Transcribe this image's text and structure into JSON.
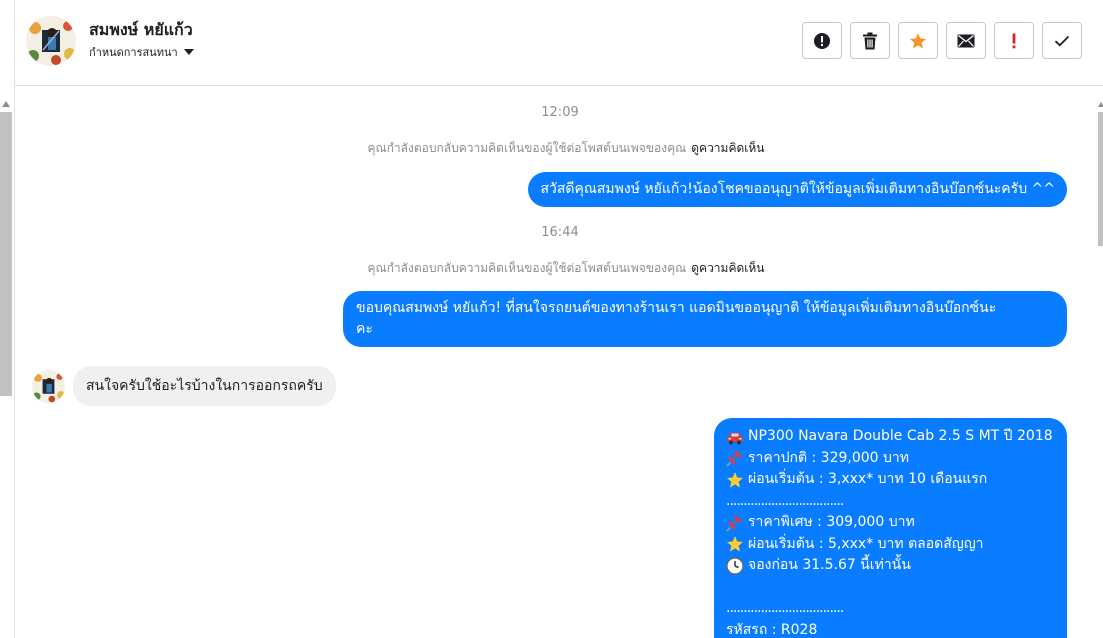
{
  "header": {
    "contact_name": "สมพงษ์ หยัแก้ว",
    "conversation_setting": "กำหนดการสนทนา",
    "actions": [
      {
        "name": "spam",
        "icon": "alert-circle-icon"
      },
      {
        "name": "delete",
        "icon": "trash-icon"
      },
      {
        "name": "star",
        "icon": "star-icon",
        "color": "#f5922a"
      },
      {
        "name": "mark-unread",
        "icon": "envelope-icon"
      },
      {
        "name": "important",
        "icon": "exclamation-icon",
        "color": "#e02020"
      },
      {
        "name": "done",
        "icon": "check-icon"
      }
    ]
  },
  "thread": {
    "time_1": "12:09",
    "notice_1": {
      "text": "คุณกำลังตอบกลับความคิดเห็นของผู้ใช้ต่อโพสต์บนเพจของคุณ",
      "link": "ดูความคิดเห็น"
    },
    "outgoing_1": "สวัสดีคุณสมพงษ์ หยัแก้ว!น้องโชคขออนุญาติให้ข้อมูลเพิ่มเติมทางอินบ๊อกซ์นะครับ ^^",
    "time_2": "16:44",
    "notice_2": {
      "text": "คุณกำลังตอบกลับความคิดเห็นของผู้ใช้ต่อโพสต์บนเพจของคุณ",
      "link": "ดูความคิดเห็น"
    },
    "outgoing_2_line1": "ขอบคุณสมพงษ์ หยัแก้ว! ที่สนใจรถยนต์ของทางร้านเรา แอดมินขออนุญาติ ให้ข้อมูลเพิ่มเติมทางอินบ๊อกซ์นะ",
    "outgoing_2_line2": "คะ",
    "incoming_1": "สนใจครับใช้อะไรบ้างในการออกรถครับ",
    "card": {
      "model": "NP300 Navara Double Cab 2.5 S MT ปี 2018",
      "normal_price": "ราคาปกติ : 329,000 บาท",
      "installment_1": "ผ่อนเริ่มต้น : 3,xxx* บาท 10 เดือนแรก",
      "separator": "..................................",
      "special_price": "ราคาพิเศษ : 309,000 บาท",
      "installment_2": "ผ่อนเริ่มต้น : 5,xxx* บาท ตลอดสัญญา",
      "deadline": "จองก่อน 31.5.67 นี้เท่านั้น",
      "car_code": "รหัสรถ : R028"
    },
    "card_icons": {
      "model": "car-emoji-icon",
      "normal_price": "pin-emoji-icon",
      "installment_1": "star-emoji-icon",
      "special_price": "pin-emoji-icon",
      "installment_2": "star-emoji-icon",
      "deadline": "clock-emoji-icon"
    }
  },
  "colors": {
    "outgoing_bubble": "#0a7cff",
    "incoming_bubble": "#f0f0f0",
    "muted_text": "#8a8d91",
    "star": "#f5922a",
    "important": "#e02020"
  }
}
